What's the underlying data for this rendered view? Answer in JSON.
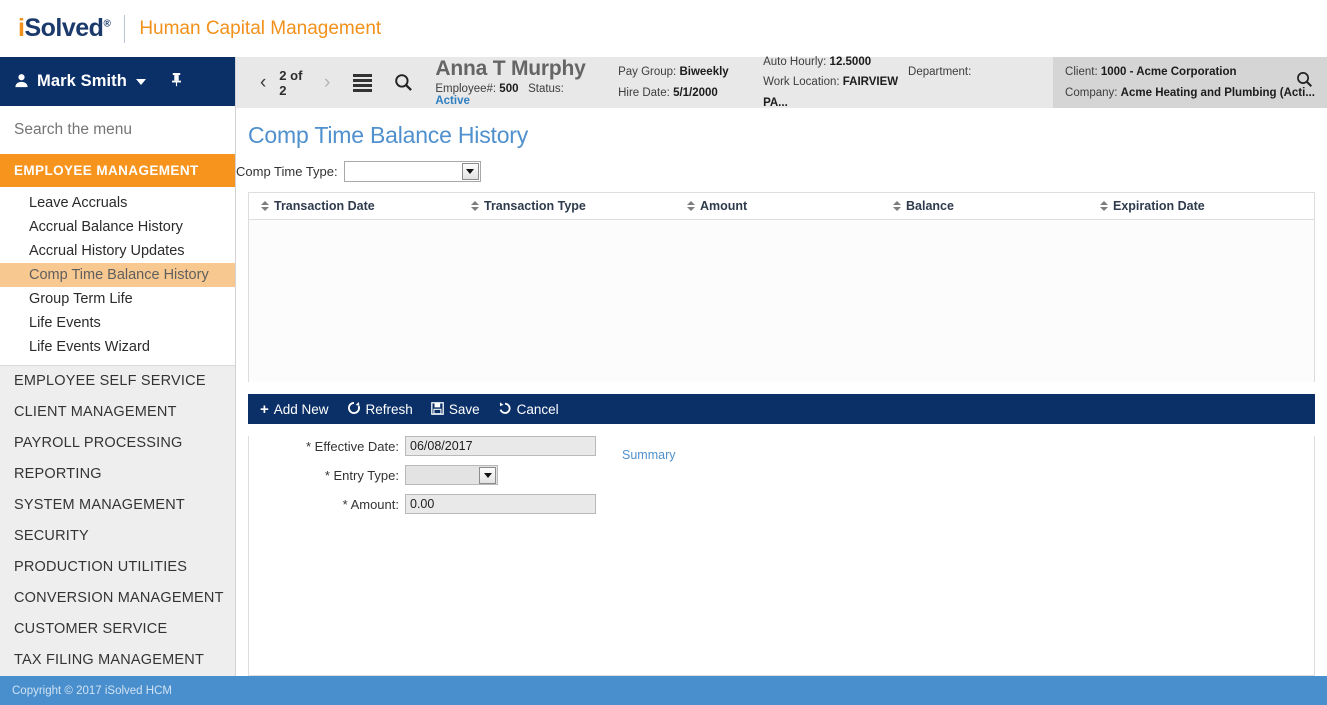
{
  "brand": {
    "logo_i": "i",
    "logo_rest": "Solved",
    "tm": "®",
    "subtitle": "Human Capital Management"
  },
  "sidebar": {
    "user": {
      "name": "Mark Smith",
      "user_icon": "user-icon",
      "pin_icon": "pin-icon"
    },
    "search_placeholder": "Search the menu",
    "active_group": "EMPLOYEE MANAGEMENT",
    "sub_items": [
      {
        "label": "Leave Accruals",
        "selected": false
      },
      {
        "label": "Accrual Balance History",
        "selected": false
      },
      {
        "label": "Accrual History Updates",
        "selected": false
      },
      {
        "label": "Comp Time Balance History",
        "selected": true
      },
      {
        "label": "Group Term Life",
        "selected": false
      },
      {
        "label": "Life Events",
        "selected": false
      },
      {
        "label": "Life Events Wizard",
        "selected": false
      }
    ],
    "groups": [
      {
        "label": "EMPLOYEE SELF SERVICE"
      },
      {
        "label": "CLIENT MANAGEMENT"
      },
      {
        "label": "PAYROLL PROCESSING"
      },
      {
        "label": "REPORTING"
      },
      {
        "label": "SYSTEM MANAGEMENT"
      },
      {
        "label": "SECURITY"
      },
      {
        "label": "PRODUCTION UTILITIES"
      },
      {
        "label": "CONVERSION MANAGEMENT"
      },
      {
        "label": "CUSTOMER SERVICE"
      },
      {
        "label": "TAX FILING MANAGEMENT"
      }
    ]
  },
  "footer": {
    "copyright": "Copyright © 2017 iSolved HCM"
  },
  "employee_header": {
    "pager": "2 of 2",
    "prev_icon": "chevron-left-icon",
    "next_icon": "chevron-right-icon",
    "list_icon": "list-icon",
    "search_icon": "search-icon",
    "name": "Anna T Murphy",
    "employee_number_label": "Employee#:",
    "employee_number": "500",
    "status_label": "Status:",
    "status": "Active",
    "pay_group_label": "Pay Group:",
    "pay_group": "Biweekly",
    "hire_date_label": "Hire Date:",
    "hire_date": "5/1/2000",
    "auto_hourly_label": "Auto Hourly:",
    "auto_hourly": "12.5000",
    "work_location_label": "Work Location:",
    "work_location": "FAIRVIEW PA...",
    "department_label": "Department:",
    "department": "",
    "client_label": "Client:",
    "client": "1000 - Acme Corporation",
    "company_label": "Company:",
    "company": "Acme Heating and Plumbing (Acti...",
    "client_search_icon": "search-icon"
  },
  "main": {
    "title": "Comp Time Balance History",
    "filter": {
      "label": "Comp Time Type:",
      "value": "",
      "dropdown_icon": "chevron-down-icon"
    },
    "grid": {
      "columns": [
        {
          "label": "Transaction Date",
          "sort_icon": "sort-icon"
        },
        {
          "label": "Transaction Type",
          "sort_icon": "sort-icon"
        },
        {
          "label": "Amount",
          "sort_icon": "sort-icon"
        },
        {
          "label": "Balance",
          "sort_icon": "sort-icon"
        },
        {
          "label": "Expiration Date",
          "sort_icon": "sort-icon"
        }
      ],
      "rows": []
    },
    "actions": [
      {
        "label": "Add New",
        "glyph": "+",
        "icon_name": "plus-icon"
      },
      {
        "label": "Refresh",
        "glyph": "⟳",
        "icon_name": "refresh-icon"
      },
      {
        "label": "Save",
        "glyph": "Ὃe",
        "icon_name": "save-disk-icon"
      },
      {
        "label": "Cancel",
        "glyph": "↺",
        "icon_name": "undo-icon"
      }
    ],
    "form": {
      "effective_date_label": "* Effective Date:",
      "effective_date_value": "06/08/2017",
      "entry_type_label": "* Entry Type:",
      "entry_type_value": "",
      "amount_label": "* Amount:",
      "amount_value": "0.00",
      "summary_link": "Summary"
    }
  },
  "colors": {
    "brand_navy": "#0b3068",
    "brand_orange": "#f7941e",
    "accent_blue": "#4f90cd",
    "footer_blue": "#4a8fcd",
    "selected_item": "#f7c890",
    "status_active": "#2d7fc1"
  }
}
